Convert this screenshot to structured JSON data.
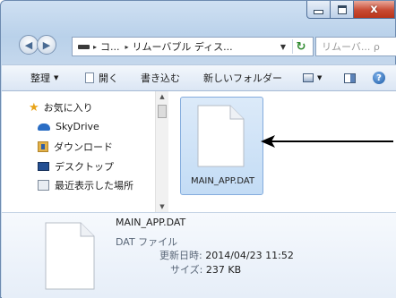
{
  "window": {
    "caption_buttons": {
      "minimize": "–",
      "maximize": "□",
      "close": "x"
    }
  },
  "address": {
    "segments": [
      "コ...",
      "リムーバブル ディス..."
    ],
    "separator": "▸",
    "search_placeholder": "リムーバ... ρ"
  },
  "toolbar": {
    "organize": "整理",
    "open": "開く",
    "burn": "書き込む",
    "new_folder": "新しいフォルダー"
  },
  "nav": {
    "favorites": "お気に入り",
    "skydrive": "SkyDrive",
    "downloads": "ダウンロード",
    "desktop": "デスクトップ",
    "recent": "最近表示した場所"
  },
  "files": [
    {
      "name": "MAIN_APP.DAT",
      "selected": true
    }
  ],
  "details": {
    "name": "MAIN_APP.DAT",
    "type": "DAT ファイル",
    "modified_label": "更新日時:",
    "modified_value": "2014/04/23 11:52",
    "size_label": "サイズ:",
    "size_value": "237 KB"
  },
  "colors": {
    "selection": "#c3dcf5",
    "close_button": "#c84a33",
    "arrow": "#000000"
  }
}
